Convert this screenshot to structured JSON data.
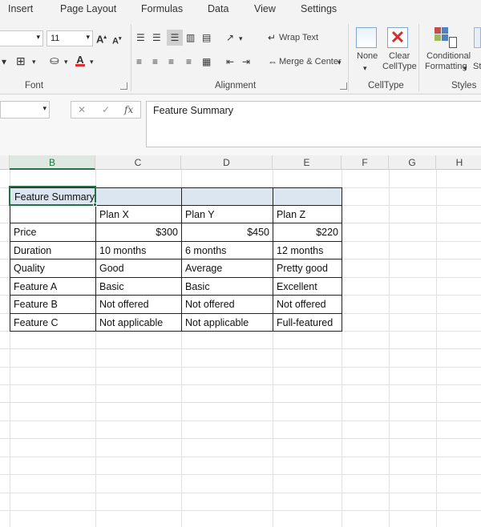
{
  "menu": {
    "tabs": [
      "Insert",
      "Page Layout",
      "Formulas",
      "Data",
      "View",
      "Settings"
    ]
  },
  "ribbon": {
    "font_size": "11",
    "wrap_text": "Wrap Text",
    "merge_center": "Merge & Center",
    "group_font": "Font",
    "group_alignment": "Alignment",
    "group_celltype": "CellType",
    "group_styles": "Styles",
    "none_label": "None",
    "clear_label_1": "Clear",
    "clear_label_2": "CellType",
    "cond_label_1": "Conditional",
    "cond_label_2": "Formatting",
    "cell_styles_partial": "St"
  },
  "formula_bar": {
    "cancel_glyph": "✕",
    "enter_glyph": "✓",
    "fx": "fx",
    "content": "Feature Summary"
  },
  "grid": {
    "columns": [
      "B",
      "C",
      "D",
      "E",
      "F",
      "G",
      "H"
    ],
    "active_column": "B",
    "title": "Feature Summary",
    "headers": [
      "Plan X",
      "Plan Y",
      "Plan Z"
    ],
    "rows": [
      {
        "label": "Price",
        "values": [
          "$300",
          "$450",
          "$220"
        ]
      },
      {
        "label": "Duration",
        "values": [
          "10 months",
          "6 months",
          "12 months"
        ]
      },
      {
        "label": "Quality",
        "values": [
          "Good",
          "Average",
          "Pretty good"
        ]
      },
      {
        "label": "Feature A",
        "values": [
          "Basic",
          "Basic",
          "Excellent"
        ]
      },
      {
        "label": "Feature B",
        "values": [
          "Not offered",
          "Not offered",
          "Not offered"
        ]
      },
      {
        "label": "Feature C",
        "values": [
          "Not applicable",
          "Not applicable",
          "Full-featured"
        ]
      }
    ]
  },
  "colors": {
    "accent": "#217346",
    "header_fill": "#dce6f1",
    "font_color_red": "#e03030"
  }
}
